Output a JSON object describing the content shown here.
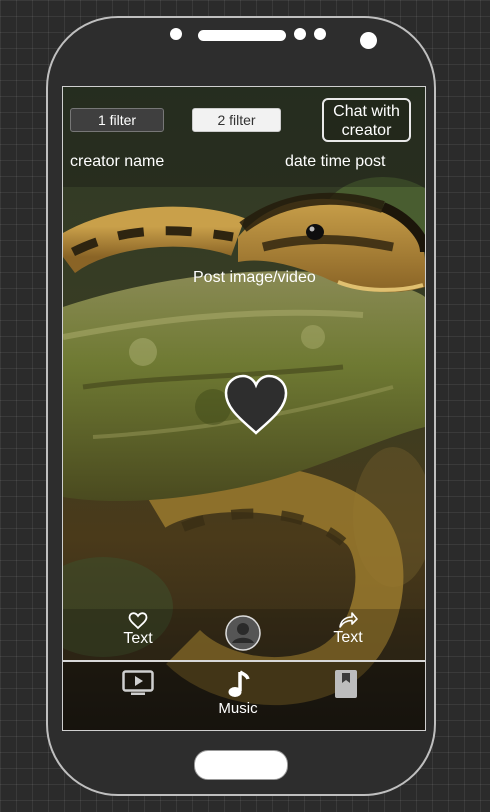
{
  "filters": {
    "first": "1 filter",
    "second": "2 filter"
  },
  "chat_button": {
    "line1": "Chat with",
    "line2": "creator"
  },
  "post": {
    "creator_name": "creator name",
    "date_time": "date time post",
    "media_label": "Post image/video"
  },
  "actions": {
    "like_label": "Text",
    "share_label": "Text"
  },
  "bottom_nav": {
    "music_label": "Music"
  },
  "icons": {
    "like": "heart-outline-icon",
    "share": "share-arrow-icon",
    "profile": "user-avatar-icon",
    "video": "video-play-icon",
    "music": "music-note-icon",
    "saved": "bookmark-icon",
    "big_like": "heart-filled-icon"
  },
  "colors": {
    "phone_body": "#2d2d2d",
    "canvas_grid": "#2b2b2b",
    "accent_white": "#ffffff"
  }
}
